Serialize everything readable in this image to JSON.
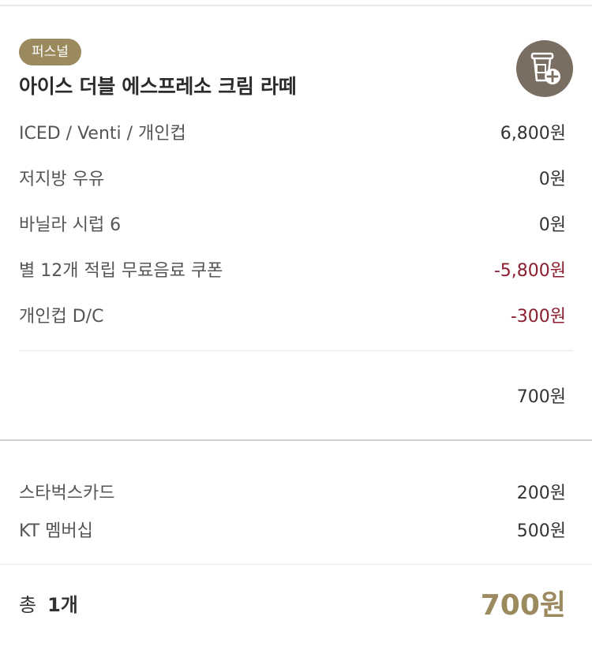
{
  "item": {
    "badge": "퍼스널",
    "name": "아이스 더블 에스프레소 크림 라떼",
    "cup_icon": "cup-add-icon"
  },
  "details": [
    {
      "label": "ICED / Venti / 개인컵",
      "price": "6,800원",
      "discount": false
    },
    {
      "label": "저지방 우유",
      "price": "0원",
      "discount": false
    },
    {
      "label": "바닐라 시럽 6",
      "price": "0원",
      "discount": false
    },
    {
      "label": "별 12개 적립 무료음료 쿠폰",
      "price": "-5,800원",
      "discount": true
    },
    {
      "label": "개인컵 D/C",
      "price": "-300원",
      "discount": true
    }
  ],
  "subtotal": "700원",
  "payments": [
    {
      "label": "스타벅스카드",
      "price": "200원"
    },
    {
      "label": "KT 멤버십",
      "price": "500원"
    }
  ],
  "total": {
    "label": "총",
    "count": "1개",
    "amount": "700원"
  },
  "colors": {
    "accent": "#9b8a5e",
    "discount": "#8b1e2e",
    "cup_button": "#7a6d62"
  }
}
